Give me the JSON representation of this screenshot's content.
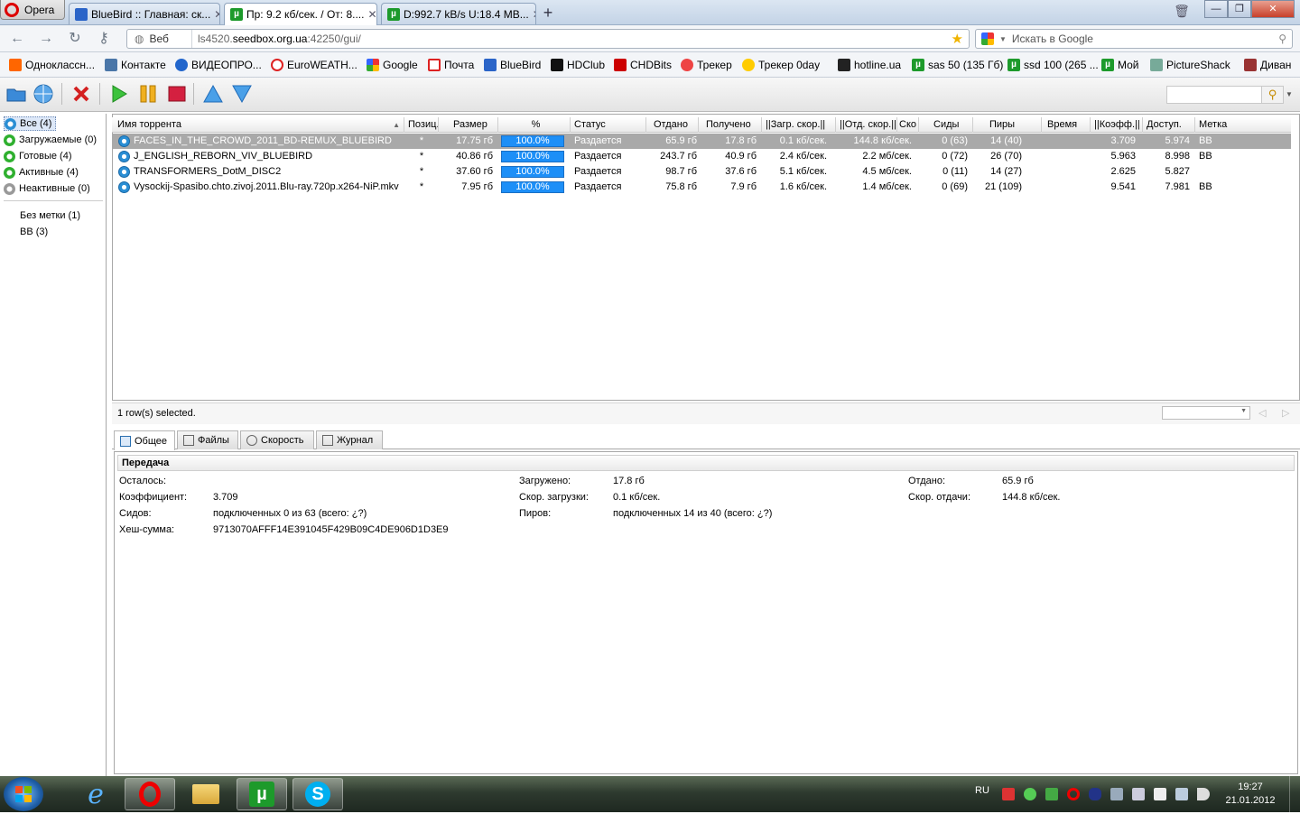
{
  "browser": {
    "menu_label": "Opera",
    "tabs": [
      {
        "title": "BlueBird :: Главная: ск..."
      },
      {
        "title": "Пр: 9.2 кб/сек. / От: 8...."
      },
      {
        "title": "D:992.7 kB/s U:18.4 MB..."
      }
    ],
    "address": {
      "mode": "Веб",
      "url_prefix": "ls4520.",
      "url_host": "seedbox.org.ua",
      "url_rest": ":42250/gui/"
    },
    "search_placeholder": "Искать в Google",
    "bookmarks": [
      "Одноклассн...",
      "Контакте",
      "ВИДЕОПРО...",
      "EuroWEATH...",
      "Google",
      "Почта",
      "BlueBird",
      "HDClub",
      "CHDBits",
      "Трекер",
      "Трекер 0day",
      "hotline.ua",
      "sas 50 (135 Гб)",
      "ssd 100 (265 ...",
      "Мой",
      "PictureShack",
      "Диван"
    ]
  },
  "sidebar": {
    "categories": [
      {
        "label": "Все (4)"
      },
      {
        "label": "Загружаемые (0)"
      },
      {
        "label": "Готовые (4)"
      },
      {
        "label": "Активные (4)"
      },
      {
        "label": "Неактивные (0)"
      }
    ],
    "labels": [
      "Без метки (1)",
      "BB (3)"
    ]
  },
  "table": {
    "columns": [
      "Имя торрента",
      "Позиц.",
      "Размер",
      "%",
      "Статус",
      "Отдано",
      "Получено",
      "||Загр. скор.||",
      "||Отд. скор.||",
      "Ско",
      "Сиды",
      "Пиры",
      "Время",
      "||Коэфф.||",
      "Доступ.",
      "Метка"
    ],
    "rows": [
      {
        "name": "FACES_IN_THE_CROWD_2011_BD-REMUX_BLUEBIRD",
        "pos": "*",
        "size": "17.75 гб",
        "pct": "100.0%",
        "status": "Раздается",
        "up": "65.9 гб",
        "down": "17.8 гб",
        "dl": "0.1 кб/сек.",
        "ul": "144.8 кб/сек.",
        "seeds": "0 (63)",
        "peers": "14 (40)",
        "time": "",
        "ratio": "3.709",
        "avail": "5.974",
        "label": "BB"
      },
      {
        "name": "J_ENGLISH_REBORN_VIV_BLUEBIRD",
        "pos": "*",
        "size": "40.86 гб",
        "pct": "100.0%",
        "status": "Раздается",
        "up": "243.7 гб",
        "down": "40.9 гб",
        "dl": "2.4 кб/сек.",
        "ul": "2.2 мб/сек.",
        "seeds": "0 (72)",
        "peers": "26 (70)",
        "time": "",
        "ratio": "5.963",
        "avail": "8.998",
        "label": "BB"
      },
      {
        "name": "TRANSFORMERS_DotM_DISC2",
        "pos": "*",
        "size": "37.60 гб",
        "pct": "100.0%",
        "status": "Раздается",
        "up": "98.7 гб",
        "down": "37.6 гб",
        "dl": "5.1 кб/сек.",
        "ul": "4.5 мб/сек.",
        "seeds": "0 (11)",
        "peers": "14 (27)",
        "time": "",
        "ratio": "2.625",
        "avail": "5.827",
        "label": ""
      },
      {
        "name": "Vysockij-Spasibo.chto.zivoj.2011.Blu-ray.720p.x264-NiP.mkv",
        "pos": "*",
        "size": "7.95 гб",
        "pct": "100.0%",
        "status": "Раздается",
        "up": "75.8 гб",
        "down": "7.9 гб",
        "dl": "1.6 кб/сек.",
        "ul": "1.4 мб/сек.",
        "seeds": "0 (69)",
        "peers": "21 (109)",
        "time": "",
        "ratio": "9.541",
        "avail": "7.981",
        "label": "BB"
      }
    ],
    "status": "1 row(s) selected."
  },
  "details": {
    "tabs": [
      "Общее",
      "Файлы",
      "Скорость",
      "Журнал"
    ],
    "section_title": "Передача",
    "fields": {
      "remaining_label": "Осталось:",
      "remaining_value": "",
      "ratio_label": "Коэффициент:",
      "ratio_value": "3.709",
      "seeds_label": "Сидов:",
      "seeds_value": "подключенных 0 из 63 (всего: ¿?)",
      "hash_label": "Хеш-сумма:",
      "hash_value": "9713070AFFF14E391045F429B09C4DE906D1D3E9",
      "downloaded_label": "Загружено:",
      "downloaded_value": "17.8 гб",
      "dl_speed_label": "Скор. загрузки:",
      "dl_speed_value": "0.1 кб/сек.",
      "peers_label": "Пиров:",
      "peers_value": "подключенных 14 из 40 (всего: ¿?)",
      "uploaded_label": "Отдано:",
      "uploaded_value": "65.9 гб",
      "ul_speed_label": "Скор. отдачи:",
      "ul_speed_value": "144.8 кб/сек."
    }
  },
  "taskbar": {
    "lang": "RU",
    "time": "19:27",
    "date": "21.01.2012"
  }
}
